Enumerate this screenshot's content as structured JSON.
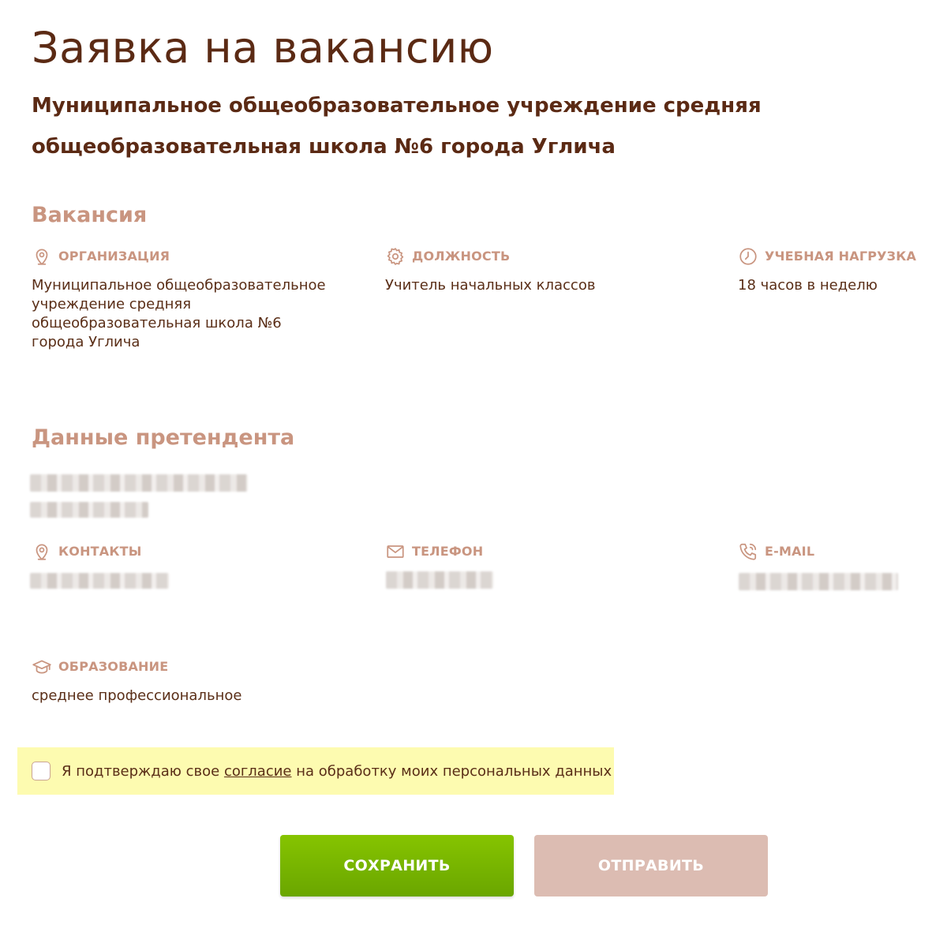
{
  "page": {
    "title": "Заявка на вакансию",
    "organization_title": "Муниципальное общеобразовательное учреждение средняя общеобразовательная школа №6 города Углича"
  },
  "vacancy": {
    "section_title": "Вакансия",
    "fields": [
      {
        "label": "Организация",
        "icon": "location-pin-icon",
        "value": "Муниципальное общеобразовательное учреждение средняя общеобразовательная школа №6 города Углича"
      },
      {
        "label": "Должность",
        "icon": "gear-icon",
        "value": "Учитель начальных классов"
      },
      {
        "label": "Учебная нагрузка",
        "icon": "clock-icon",
        "value": "18 часов в неделю"
      }
    ]
  },
  "applicant": {
    "section_title": "Данные претендента",
    "fields": [
      {
        "label": "Контакты",
        "icon": "location-pin-icon"
      },
      {
        "label": "Телефон",
        "icon": "envelope-icon"
      },
      {
        "label": "E-mail",
        "icon": "phone-icon"
      },
      {
        "label": "Образование",
        "icon": "graduation-cap-icon",
        "value": "среднее профессиональное"
      }
    ]
  },
  "consent": {
    "text_before": "Я подтверждаю свое ",
    "link_text": "согласие",
    "text_after": " на обработку моих персональных данных",
    "checked": false
  },
  "actions": {
    "save_label": "Сохранить",
    "send_label": "Отправить"
  },
  "colors": {
    "heading": "#5b2a14",
    "accent": "#c99580",
    "save_button": "#7ab500",
    "send_button_disabled": "#dcbcb2",
    "consent_highlight": "#fdfbb0"
  }
}
